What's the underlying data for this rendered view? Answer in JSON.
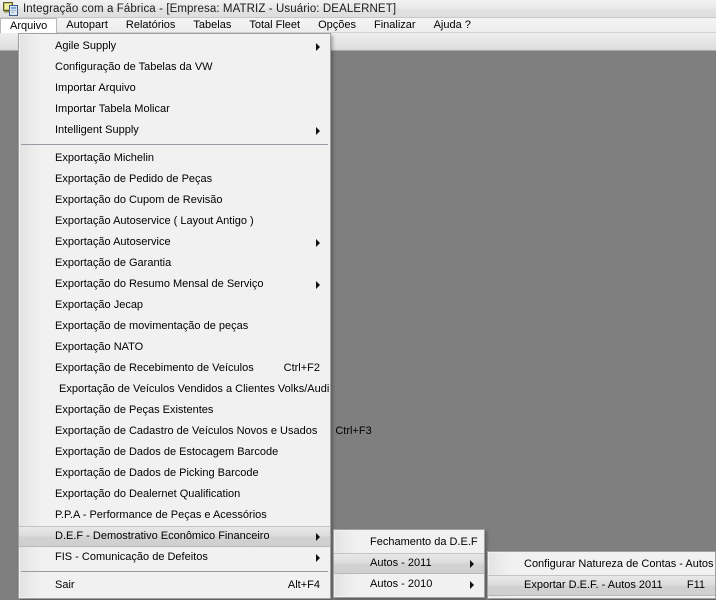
{
  "window": {
    "title": "Integração com a Fábrica - [Empresa: MATRIZ - Usuário: DEALERNET]",
    "icon": "application-icon"
  },
  "menubar": {
    "items": [
      {
        "label": "Arquivo",
        "active": true
      },
      {
        "label": "Autopart",
        "active": false
      },
      {
        "label": "Relatórios",
        "active": false
      },
      {
        "label": "Tabelas",
        "active": false
      },
      {
        "label": "Total Fleet",
        "active": false
      },
      {
        "label": "Opções",
        "active": false
      },
      {
        "label": "Finalizar",
        "active": false
      },
      {
        "label": "Ajuda ?",
        "active": false
      }
    ]
  },
  "menu_arquivo": {
    "items": [
      {
        "label": "Agile Supply",
        "accel": "",
        "submenu": true,
        "highlight": false,
        "indent": false
      },
      {
        "label": "Configuração de Tabelas da VW",
        "accel": "",
        "submenu": false,
        "highlight": false,
        "indent": false
      },
      {
        "label": "Importar Arquivo",
        "accel": "",
        "submenu": false,
        "highlight": false,
        "indent": false
      },
      {
        "label": "Importar Tabela Molicar",
        "accel": "",
        "submenu": false,
        "highlight": false,
        "indent": false
      },
      {
        "label": "Intelligent Supply",
        "accel": "",
        "submenu": true,
        "highlight": false,
        "indent": false
      },
      {
        "separator": true
      },
      {
        "label": "Exportação Michelin",
        "accel": "",
        "submenu": false,
        "highlight": false,
        "indent": false
      },
      {
        "label": "Exportação de Pedido de Peças",
        "accel": "",
        "submenu": false,
        "highlight": false,
        "indent": false
      },
      {
        "label": "Exportação do Cupom de Revisão",
        "accel": "",
        "submenu": false,
        "highlight": false,
        "indent": false
      },
      {
        "label": "Exportação Autoservice ( Layout Antigo )",
        "accel": "",
        "submenu": false,
        "highlight": false,
        "indent": false
      },
      {
        "label": "Exportação Autoservice",
        "accel": "",
        "submenu": true,
        "highlight": false,
        "indent": false
      },
      {
        "label": "Exportação de Garantia",
        "accel": "",
        "submenu": false,
        "highlight": false,
        "indent": false
      },
      {
        "label": "Exportação do Resumo Mensal de Serviço",
        "accel": "",
        "submenu": true,
        "highlight": false,
        "indent": false
      },
      {
        "label": "Exportação Jecap",
        "accel": "",
        "submenu": false,
        "highlight": false,
        "indent": false
      },
      {
        "label": "Exportação de movimentação de peças",
        "accel": "",
        "submenu": false,
        "highlight": false,
        "indent": false
      },
      {
        "label": "Exportação NATO",
        "accel": "",
        "submenu": false,
        "highlight": false,
        "indent": false
      },
      {
        "label": "Exportação de Recebimento de Veículos",
        "accel": "Ctrl+F2",
        "submenu": false,
        "highlight": false,
        "indent": false
      },
      {
        "label": "Exportação de Veículos Vendidos a Clientes Volks/Audi",
        "accel": "",
        "submenu": false,
        "highlight": false,
        "indent": true
      },
      {
        "label": "Exportação de Peças Existentes",
        "accel": "",
        "submenu": false,
        "highlight": false,
        "indent": false
      },
      {
        "label": "Exportação de Cadastro de Veículos Novos e Usados",
        "accel": "Ctrl+F3",
        "submenu": false,
        "highlight": false,
        "indent": false
      },
      {
        "label": "Exportação de Dados de Estocagem Barcode",
        "accel": "",
        "submenu": false,
        "highlight": false,
        "indent": false
      },
      {
        "label": "Exportação de Dados de Picking Barcode",
        "accel": "",
        "submenu": false,
        "highlight": false,
        "indent": false
      },
      {
        "label": "Exportação do Dealernet Qualification",
        "accel": "",
        "submenu": false,
        "highlight": false,
        "indent": false
      },
      {
        "label": "P.P.A - Performance de Peças e Acessórios",
        "accel": "",
        "submenu": false,
        "highlight": false,
        "indent": false
      },
      {
        "label": "D.E.F - Demostrativo Econômico Financeiro",
        "accel": "",
        "submenu": true,
        "highlight": true,
        "indent": false
      },
      {
        "label": "FIS - Comunicação de Defeitos",
        "accel": "",
        "submenu": true,
        "highlight": false,
        "indent": false
      },
      {
        "separator": true
      },
      {
        "label": "Sair",
        "accel": "Alt+F4",
        "submenu": false,
        "highlight": false,
        "indent": false
      }
    ]
  },
  "menu_def": {
    "items": [
      {
        "label": "Fechamento da D.E.F",
        "accel": "",
        "submenu": false,
        "highlight": false,
        "indent": false
      },
      {
        "label": "Autos - 2011",
        "accel": "",
        "submenu": true,
        "highlight": true,
        "indent": false
      },
      {
        "label": "Autos - 2010",
        "accel": "",
        "submenu": true,
        "highlight": false,
        "indent": false
      }
    ]
  },
  "menu_autos_2011": {
    "items": [
      {
        "label": "Configurar Natureza de Contas - Autos",
        "accel": "",
        "submenu": false,
        "highlight": false,
        "indent": false
      },
      {
        "label": "Exportar D.E.F. - Autos 2011",
        "accel": "F11",
        "submenu": false,
        "highlight": true,
        "indent": false
      }
    ]
  },
  "colors": {
    "workspace": "#7f7f7f",
    "menu_bg": "#f1f1f1",
    "menu_border": "#a0a0a0",
    "highlight": "#d6d6d6",
    "separator": "#9a9aa6",
    "titlebar": "#ececec"
  }
}
